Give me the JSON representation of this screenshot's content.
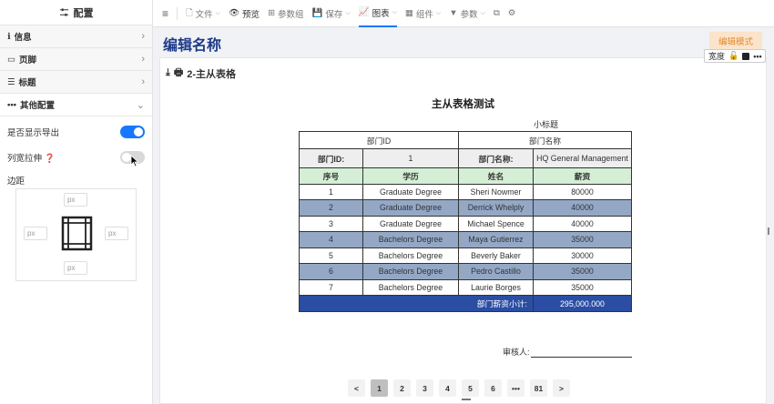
{
  "sidebar": {
    "header": "配置",
    "sections": [
      {
        "label": "信息"
      },
      {
        "label": "页脚"
      },
      {
        "label": "标题"
      },
      {
        "label": "其他配置"
      }
    ],
    "show_export_label": "是否显示导出",
    "show_export": true,
    "col_resize_label": "列宽拉伸",
    "col_resize": false,
    "margin_label": "边距",
    "margin_placeholder": "px"
  },
  "toolbar": {
    "file": "文件",
    "preview": "预览",
    "params_group": "参数组",
    "save": "保存",
    "chart": "图表",
    "component": "组件",
    "params": "参数"
  },
  "page": {
    "title": "编辑名称",
    "edit_mode": "编辑模式",
    "width_label": "宽度"
  },
  "card": {
    "title": "2-主从表格"
  },
  "report": {
    "title": "主从表格测试",
    "subtitle": "小标题",
    "dept_id_header": "部门ID",
    "dept_name_header": "部门名称",
    "dept_id_label": "部门ID:",
    "dept_id_value": "1",
    "dept_name_label": "部门名称:",
    "dept_name_value": "HQ General Management",
    "columns": [
      "序号",
      "学历",
      "姓名",
      "薪资"
    ],
    "rows": [
      [
        "1",
        "Graduate Degree",
        "Sheri Nowmer",
        "80000"
      ],
      [
        "2",
        "Graduate Degree",
        "Derrick Whelply",
        "40000"
      ],
      [
        "3",
        "Graduate Degree",
        "Michael Spence",
        "40000"
      ],
      [
        "4",
        "Bachelors Degree",
        "Maya Gutierrez",
        "35000"
      ],
      [
        "5",
        "Bachelors Degree",
        "Beverly Baker",
        "30000"
      ],
      [
        "6",
        "Bachelors Degree",
        "Pedro Castillo",
        "35000"
      ],
      [
        "7",
        "Bachelors Degree",
        "Laurie Borges",
        "35000"
      ]
    ],
    "subtotal_label": "部门薪资小计:",
    "subtotal_value": "295,000.000",
    "reviewer_label": "审核人:"
  },
  "pager": {
    "prev": "<",
    "pages": [
      "1",
      "2",
      "3",
      "4",
      "5",
      "6",
      "•••",
      "81"
    ],
    "current": "1",
    "next": ">"
  }
}
